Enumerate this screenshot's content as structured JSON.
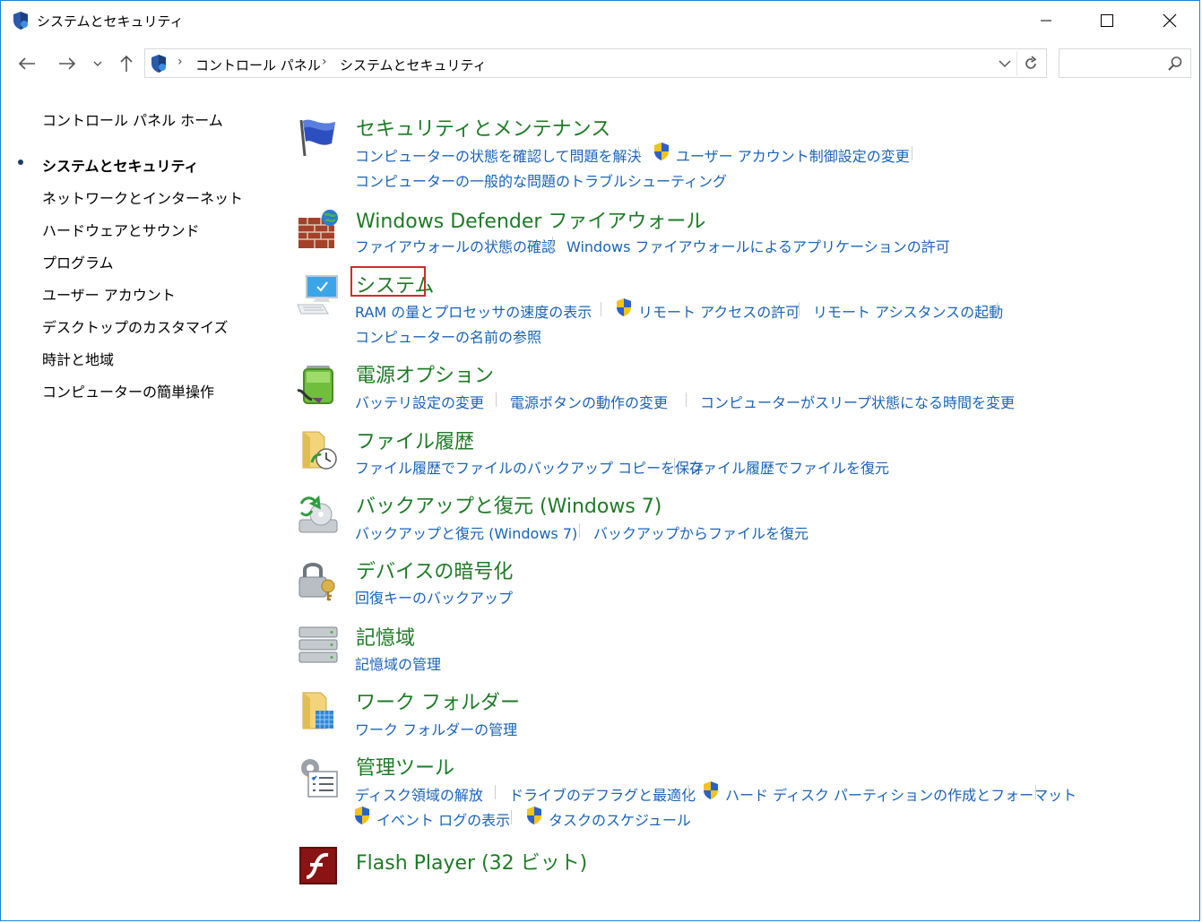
{
  "window": {
    "title": "システムとセキュリティ"
  },
  "address": {
    "crumbs": [
      "コントロール パネル",
      "システムとセキュリティ"
    ],
    "search_placeholder": ""
  },
  "sidebar": {
    "items": [
      {
        "label": "コントロール パネル ホーム",
        "current": false
      },
      {
        "label": "システムとセキュリティ",
        "current": true
      },
      {
        "label": "ネットワークとインターネット",
        "current": false
      },
      {
        "label": "ハードウェアとサウンド",
        "current": false
      },
      {
        "label": "プログラム",
        "current": false
      },
      {
        "label": "ユーザー アカウント",
        "current": false
      },
      {
        "label": "デスクトップのカスタマイズ",
        "current": false
      },
      {
        "label": "時計と地域",
        "current": false
      },
      {
        "label": "コンピューターの簡単操作",
        "current": false
      }
    ]
  },
  "categories": [
    {
      "title": "セキュリティとメンテナンス",
      "icon": "flag-icon",
      "links": [
        "コンピューターの状態を確認して問題を解決",
        "ユーザー アカウント制御設定の変更",
        "コンピューターの一般的な問題のトラブルシューティング"
      ]
    },
    {
      "title": "Windows Defender ファイアウォール",
      "icon": "firewall-icon",
      "links": [
        "ファイアウォールの状態の確認",
        "Windows ファイアウォールによるアプリケーションの許可"
      ]
    },
    {
      "title": "システム",
      "icon": "computer-icon",
      "links": [
        "RAM の量とプロセッサの速度の表示",
        "リモート アクセスの許可",
        "リモート アシスタンスの起動",
        "コンピューターの名前の参照"
      ]
    },
    {
      "title": "電源オプション",
      "icon": "battery-icon",
      "links": [
        "バッテリ設定の変更",
        "電源ボタンの動作の変更",
        "コンピューターがスリープ状態になる時間を変更"
      ]
    },
    {
      "title": "ファイル履歴",
      "icon": "file-history-icon",
      "links": [
        "ファイル履歴でファイルのバックアップ コピーを保存",
        "ファイル履歴でファイルを復元"
      ]
    },
    {
      "title": "バックアップと復元 (Windows 7)",
      "icon": "backup-icon",
      "links": [
        "バックアップと復元 (Windows 7)",
        "バックアップからファイルを復元"
      ]
    },
    {
      "title": "デバイスの暗号化",
      "icon": "encryption-lock-icon",
      "links": [
        "回復キーのバックアップ"
      ]
    },
    {
      "title": "記憶域",
      "icon": "storage-icon",
      "links": [
        "記憶域の管理"
      ]
    },
    {
      "title": "ワーク フォルダー",
      "icon": "work-folders-icon",
      "links": [
        "ワーク フォルダーの管理"
      ]
    },
    {
      "title": "管理ツール",
      "icon": "admin-tools-icon",
      "links": [
        "ディスク領域の解放",
        "ドライブのデフラグと最適化",
        "ハード ディスク パーティションの作成とフォーマット",
        "イベント ログの表示",
        "タスクのスケジュール"
      ]
    },
    {
      "title": "Flash Player (32 ビット)",
      "icon": "flash-icon",
      "links": []
    }
  ],
  "colors": {
    "title_green": "#1e7b25",
    "link_blue": "#1a63b8",
    "highlight_red": "#d42a2a"
  }
}
